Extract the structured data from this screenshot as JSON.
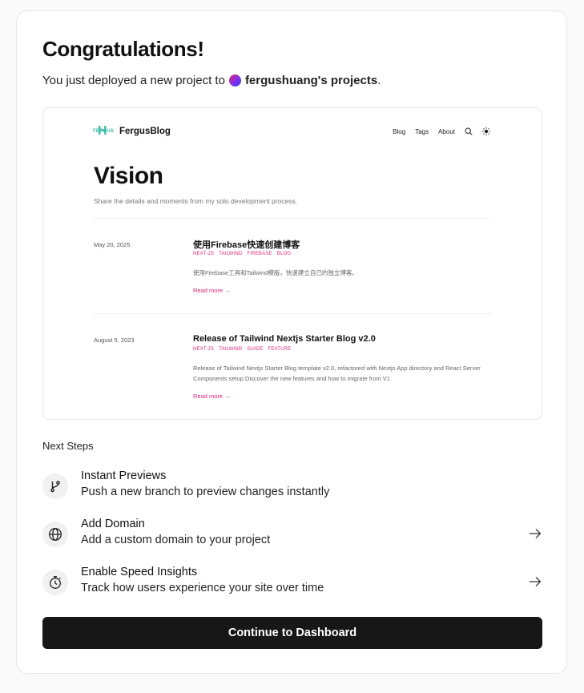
{
  "header": {
    "title": "Congratulations!",
    "subtitle_prefix": "You just deployed a new project to",
    "team_name": "fergushuang's projects",
    "subtitle_suffix": "."
  },
  "preview": {
    "logo_text": "FERGUS",
    "site_name": "FergusBlog",
    "nav": [
      "Blog",
      "Tags",
      "About"
    ],
    "heading": "Vision",
    "description": "Share the details and moments from my solo development process.",
    "posts": [
      {
        "date": "May 20, 2025",
        "title": "使用Firebase快速创建博客",
        "tags": [
          "NEXT-JS",
          "TAILWIND",
          "FIREBASE",
          "BLOG"
        ],
        "summary": "使用Firebase工具和Tailwind模版，快速建立自己的独立博客。",
        "read_more": "Read more →"
      },
      {
        "date": "August 5, 2023",
        "title": "Release of Tailwind Nextjs Starter Blog v2.0",
        "tags": [
          "NEXT-JS",
          "TAILWIND",
          "GUIDE",
          "FEATURE"
        ],
        "summary": "Release of Tailwind Nextjs Starter Blog template v2.0, refactored with Nextjs App directory and React Server Components setup.Discover the new features and how to migrate from V1.",
        "read_more": "Read more →"
      }
    ]
  },
  "next_steps": {
    "label": "Next Steps",
    "items": [
      {
        "title": "Instant Previews",
        "description": "Push a new branch to preview changes instantly",
        "icon": "git-branch-icon"
      },
      {
        "title": "Add Domain",
        "description": "Add a custom domain to your project",
        "icon": "globe-icon"
      },
      {
        "title": "Enable Speed Insights",
        "description": "Track how users experience your site over time",
        "icon": "stopwatch-icon"
      }
    ]
  },
  "cta": {
    "label": "Continue to Dashboard"
  },
  "colors": {
    "accent_pink": "#e0267a",
    "button_bg": "#171717",
    "logo_teal": "#37b9a6"
  }
}
